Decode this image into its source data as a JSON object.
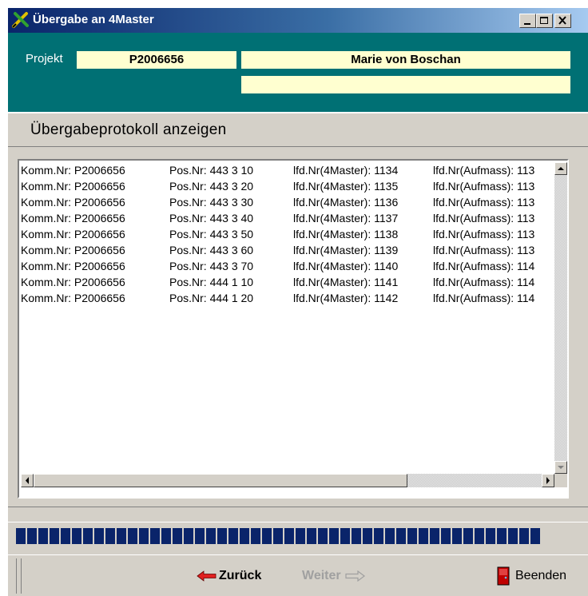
{
  "window": {
    "title": "Übergabe an 4Master",
    "buttons": [
      "minimize-icon",
      "maximize-icon",
      "close-icon"
    ],
    "accent": "#007074"
  },
  "header": {
    "project_label": "Projekt",
    "project_number": "P2006656",
    "customer_name": "Marie von Boschan",
    "customer_line2": ""
  },
  "section": {
    "title": "Übergabeprotokoll anzeigen"
  },
  "protocol": {
    "rows": [
      {
        "komm": "Komm.Nr: P2006656",
        "pos": "Pos.Nr: 443 3 10",
        "lfd_4master": "lfd.Nr(4Master): 1134",
        "lfd_aufmass": "lfd.Nr(Aufmass): 113"
      },
      {
        "komm": "Komm.Nr: P2006656",
        "pos": "Pos.Nr: 443 3 20",
        "lfd_4master": "lfd.Nr(4Master): 1135",
        "lfd_aufmass": "lfd.Nr(Aufmass): 113"
      },
      {
        "komm": "Komm.Nr: P2006656",
        "pos": "Pos.Nr: 443 3 30",
        "lfd_4master": "lfd.Nr(4Master): 1136",
        "lfd_aufmass": "lfd.Nr(Aufmass): 113"
      },
      {
        "komm": "Komm.Nr: P2006656",
        "pos": "Pos.Nr: 443 3 40",
        "lfd_4master": "lfd.Nr(4Master): 1137",
        "lfd_aufmass": "lfd.Nr(Aufmass): 113"
      },
      {
        "komm": "Komm.Nr: P2006656",
        "pos": "Pos.Nr: 443 3 50",
        "lfd_4master": "lfd.Nr(4Master): 1138",
        "lfd_aufmass": "lfd.Nr(Aufmass): 113"
      },
      {
        "komm": "Komm.Nr: P2006656",
        "pos": "Pos.Nr: 443 3 60",
        "lfd_4master": "lfd.Nr(4Master): 1139",
        "lfd_aufmass": "lfd.Nr(Aufmass): 113"
      },
      {
        "komm": "Komm.Nr: P2006656",
        "pos": "Pos.Nr: 443 3 70",
        "lfd_4master": "lfd.Nr(4Master): 1140",
        "lfd_aufmass": "lfd.Nr(Aufmass): 114"
      },
      {
        "komm": "Komm.Nr: P2006656",
        "pos": "Pos.Nr: 444 1 10",
        "lfd_4master": "lfd.Nr(4Master): 1141",
        "lfd_aufmass": "lfd.Nr(Aufmass): 114"
      },
      {
        "komm": "Komm.Nr: P2006656",
        "pos": "Pos.Nr: 444 1 20",
        "lfd_4master": "lfd.Nr(4Master): 1142",
        "lfd_aufmass": "lfd.Nr(Aufmass): 114"
      }
    ]
  },
  "progress": {
    "fraction": 0.95,
    "color": "#0a246a"
  },
  "footer": {
    "back_label": "Zurück",
    "next_label": "Weiter",
    "end_label": "Beenden",
    "back_icon": "arrow-left-icon",
    "next_icon": "arrow-right-icon",
    "end_icon": "exit-door-icon"
  }
}
